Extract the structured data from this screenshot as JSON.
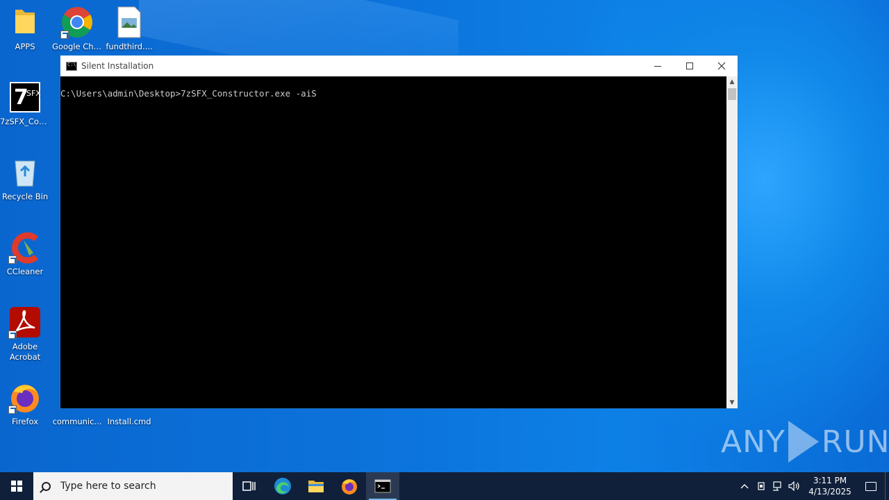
{
  "desktop": {
    "icons": [
      {
        "label": "APPS"
      },
      {
        "label": "Google Chrome"
      },
      {
        "label": "fundthird...."
      },
      {
        "label": "7zSFX_Con..."
      },
      {
        "label": "Recycle Bin"
      },
      {
        "label": "CCleaner"
      },
      {
        "label": "Adobe Acrobat"
      },
      {
        "label": "Firefox"
      },
      {
        "label": "communic..."
      },
      {
        "label": "Install.cmd"
      }
    ],
    "watermark": {
      "left": "ANY",
      "right": "RUN"
    }
  },
  "console": {
    "title": "Silent Installation",
    "text": "C:\\Users\\admin\\Desktop>7zSFX_Constructor.exe -aiS"
  },
  "taskbar": {
    "search_placeholder": "Type here to search",
    "time": "3:11 PM",
    "date": "4/13/2025"
  }
}
